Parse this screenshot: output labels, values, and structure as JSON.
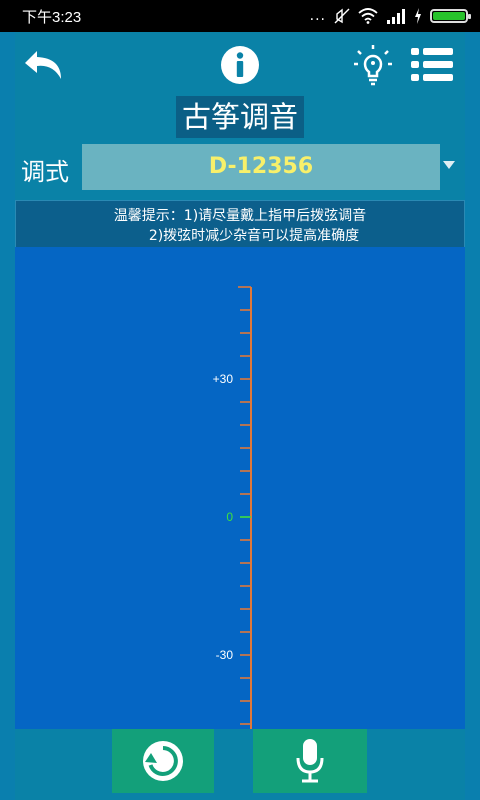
{
  "status_bar": {
    "time": "下午3:23",
    "dots": "..."
  },
  "app": {
    "title": "古筝调音"
  },
  "tuning": {
    "label": "调式",
    "value": "D-12356"
  },
  "tips": {
    "line1": "温馨提示：1)请尽量戴上指甲后拨弦调音",
    "line2": "2)拨弦时减少杂音可以提高准确度"
  },
  "meter": {
    "labels": [
      {
        "text": "+30",
        "value": 30,
        "color": "#ffffff"
      },
      {
        "text": "0",
        "value": 0,
        "color": "#3fe03f"
      },
      {
        "text": "-30",
        "value": -30,
        "color": "#ffffff"
      }
    ],
    "range": [
      -50,
      50
    ],
    "tick_step": 5,
    "scale_color": "#e0783a",
    "zero_color": "#3fe03f"
  },
  "colors": {
    "background": "#0a82a7",
    "meter_bg": "#0566c4",
    "select_text": "#f8f06a",
    "button_green": "#13a07a"
  },
  "icons": {
    "back": "undo-arrow-icon",
    "info": "info-icon",
    "bulb": "lightbulb-icon",
    "menu": "list-menu-icon",
    "refresh": "refresh-icon",
    "mic": "microphone-icon"
  }
}
